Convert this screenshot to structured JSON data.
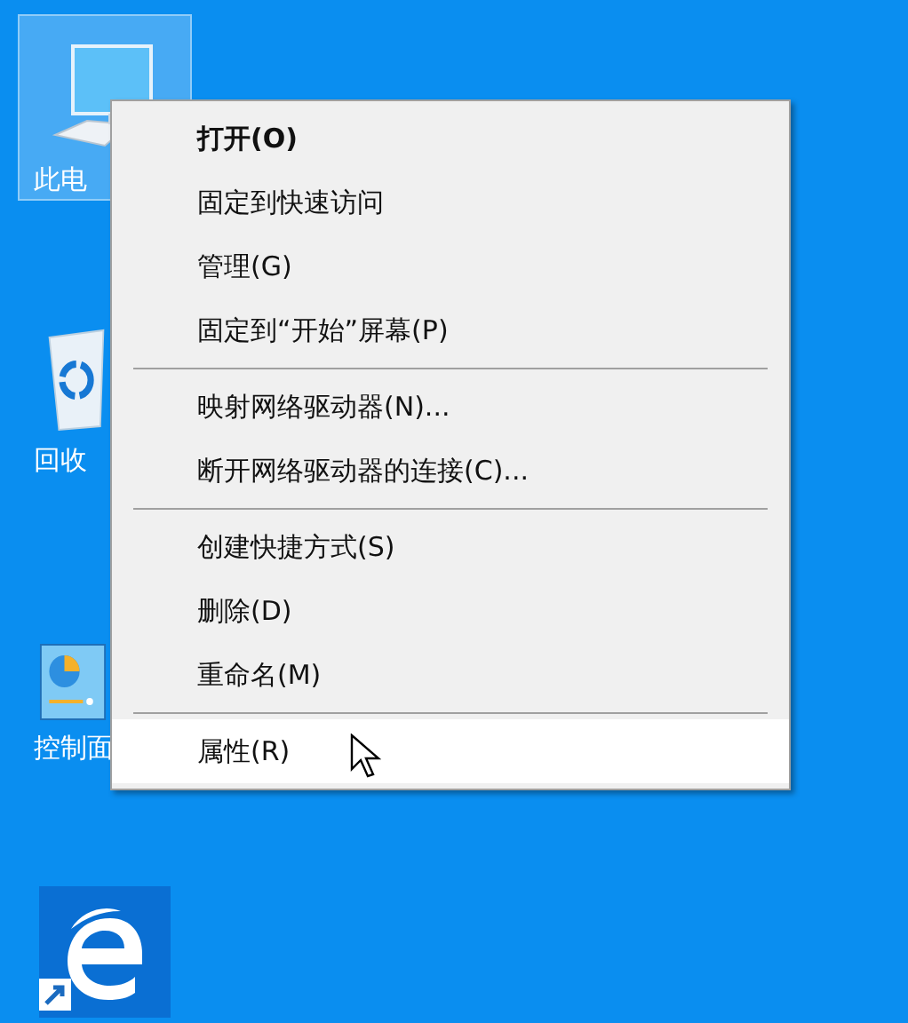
{
  "desktop_icons": [
    {
      "kind": "computer",
      "label": "此电",
      "selected": true
    },
    {
      "kind": "recycle",
      "label": "回收",
      "selected": false
    },
    {
      "kind": "control",
      "label": "控制面",
      "selected": false
    },
    {
      "kind": "edge",
      "selected": false
    }
  ],
  "context_menu": {
    "items": [
      {
        "kind": "item",
        "label": "打开(O)",
        "default": true,
        "selected": false
      },
      {
        "kind": "item",
        "label": "固定到快速访问",
        "default": false,
        "selected": false
      },
      {
        "kind": "item",
        "label": "管理(G)",
        "default": false,
        "selected": false
      },
      {
        "kind": "item",
        "label": "固定到“开始”屏幕(P)",
        "default": false,
        "selected": false
      },
      {
        "kind": "separator"
      },
      {
        "kind": "item",
        "label": "映射网络驱动器(N)...",
        "default": false,
        "selected": false
      },
      {
        "kind": "item",
        "label": "断开网络驱动器的连接(C)...",
        "default": false,
        "selected": false
      },
      {
        "kind": "separator"
      },
      {
        "kind": "item",
        "label": "创建快捷方式(S)",
        "default": false,
        "selected": false
      },
      {
        "kind": "item",
        "label": "删除(D)",
        "default": false,
        "selected": false
      },
      {
        "kind": "item",
        "label": "重命名(M)",
        "default": false,
        "selected": false
      },
      {
        "kind": "separator"
      },
      {
        "kind": "item",
        "label": "属性(R)",
        "default": false,
        "selected": true
      }
    ]
  }
}
